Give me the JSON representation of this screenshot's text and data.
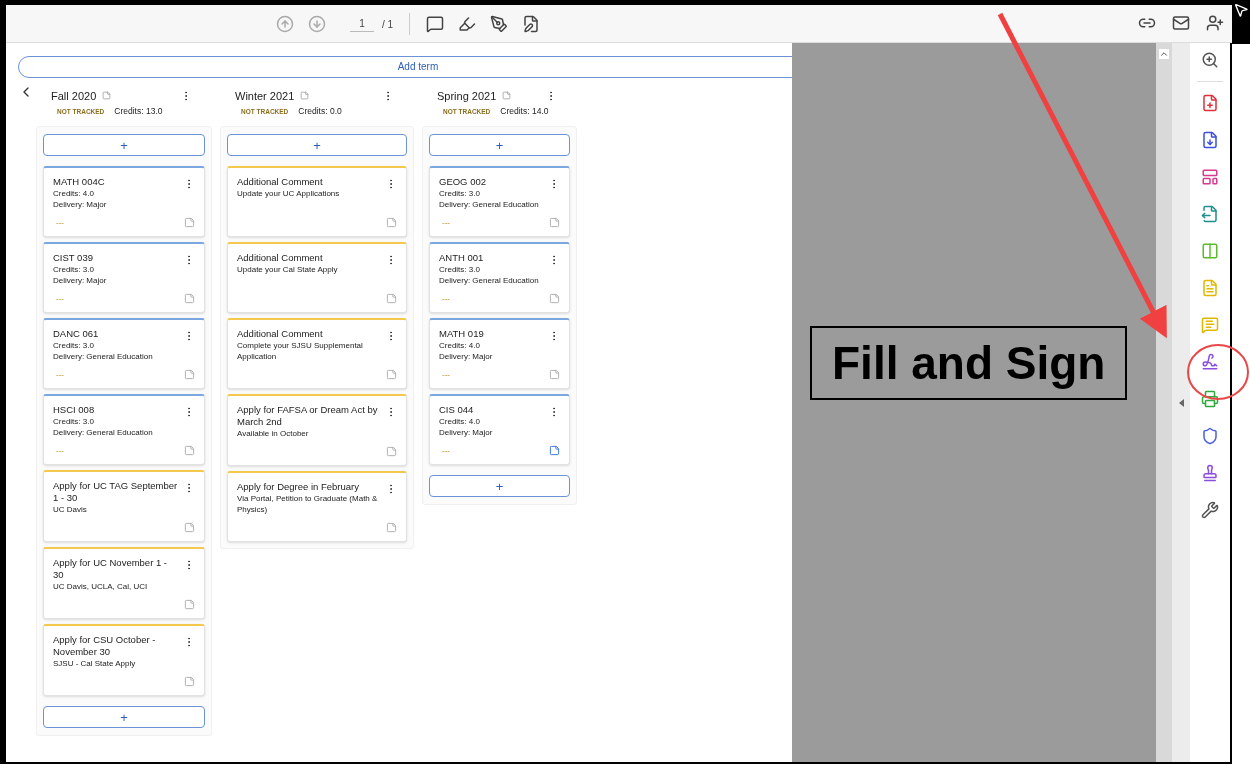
{
  "toolbar": {
    "page_current": "1",
    "page_total": "/ 1"
  },
  "add_term": "Add term",
  "terms": [
    {
      "name": "Fall 2020",
      "status": "NOT TRACKED",
      "credits": "Credits: 13.0",
      "top_add": "+",
      "bottom_add": "+",
      "cards": [
        {
          "kind": "course",
          "title": "MATH 004C",
          "lines": [
            "Credits: 4.0",
            "Delivery: Major"
          ],
          "footer": "---",
          "note_active": false
        },
        {
          "kind": "course",
          "title": "CIST 039",
          "lines": [
            "Credits: 3.0",
            "Delivery: Major"
          ],
          "footer": "---",
          "note_active": false
        },
        {
          "kind": "course",
          "title": "DANC 061",
          "lines": [
            "Credits: 3.0",
            "Delivery: General Education"
          ],
          "footer": "---",
          "note_active": false
        },
        {
          "kind": "course",
          "title": "HSCI 008",
          "lines": [
            "Credits: 3.0",
            "Delivery: General Education"
          ],
          "footer": "---",
          "note_active": false
        },
        {
          "kind": "comment",
          "title": "Apply for UC TAG September 1 - 30",
          "lines": [
            "UC Davis"
          ],
          "note_active": false
        },
        {
          "kind": "comment",
          "title": "Apply for UC November 1 - 30",
          "lines": [
            "UC Davis, UCLA, Cal, UCI"
          ],
          "note_active": false
        },
        {
          "kind": "comment",
          "title": "Apply for CSU October - November 30",
          "lines": [
            "SJSU - Cal State Apply"
          ],
          "note_active": false
        }
      ]
    },
    {
      "name": "Winter 2021",
      "status": "NOT TRACKED",
      "credits": "Credits: 0.0",
      "top_add": "+",
      "cards": [
        {
          "kind": "comment",
          "title": "Additional Comment",
          "lines": [
            "Update your UC Applications"
          ],
          "note_active": false
        },
        {
          "kind": "comment",
          "title": "Additional Comment",
          "lines": [
            "Update your Cal State Apply"
          ],
          "note_active": false
        },
        {
          "kind": "comment",
          "title": "Additional Comment",
          "lines": [
            "Complete your SJSU Supplemental Application"
          ],
          "note_active": false
        },
        {
          "kind": "comment",
          "title": "Apply for FAFSA or Dream Act by March 2nd",
          "lines": [
            "Available in October"
          ],
          "note_active": false
        },
        {
          "kind": "comment",
          "title": "Apply for Degree in February",
          "lines": [
            "Via Portal, Petition to Graduate (Math & Physics)"
          ],
          "note_active": false
        }
      ]
    },
    {
      "name": "Spring 2021",
      "status": "NOT TRACKED",
      "credits": "Credits: 14.0",
      "top_add": "+",
      "bottom_add": "+",
      "cards": [
        {
          "kind": "course",
          "title": "GEOG 002",
          "lines": [
            "Credits: 3.0",
            "Delivery: General Education"
          ],
          "footer": "---",
          "note_active": false
        },
        {
          "kind": "course",
          "title": "ANTH 001",
          "lines": [
            "Credits: 3.0",
            "Delivery: General Education"
          ],
          "footer": "---",
          "note_active": false
        },
        {
          "kind": "course",
          "title": "MATH 019",
          "lines": [
            "Credits: 4.0",
            "Delivery: Major"
          ],
          "footer": "---",
          "note_active": false
        },
        {
          "kind": "course",
          "title": "CIS 044",
          "lines": [
            "Credits: 4.0",
            "Delivery: Major"
          ],
          "footer": "---",
          "note_active": true
        }
      ]
    }
  ],
  "callout": "Fill and Sign"
}
